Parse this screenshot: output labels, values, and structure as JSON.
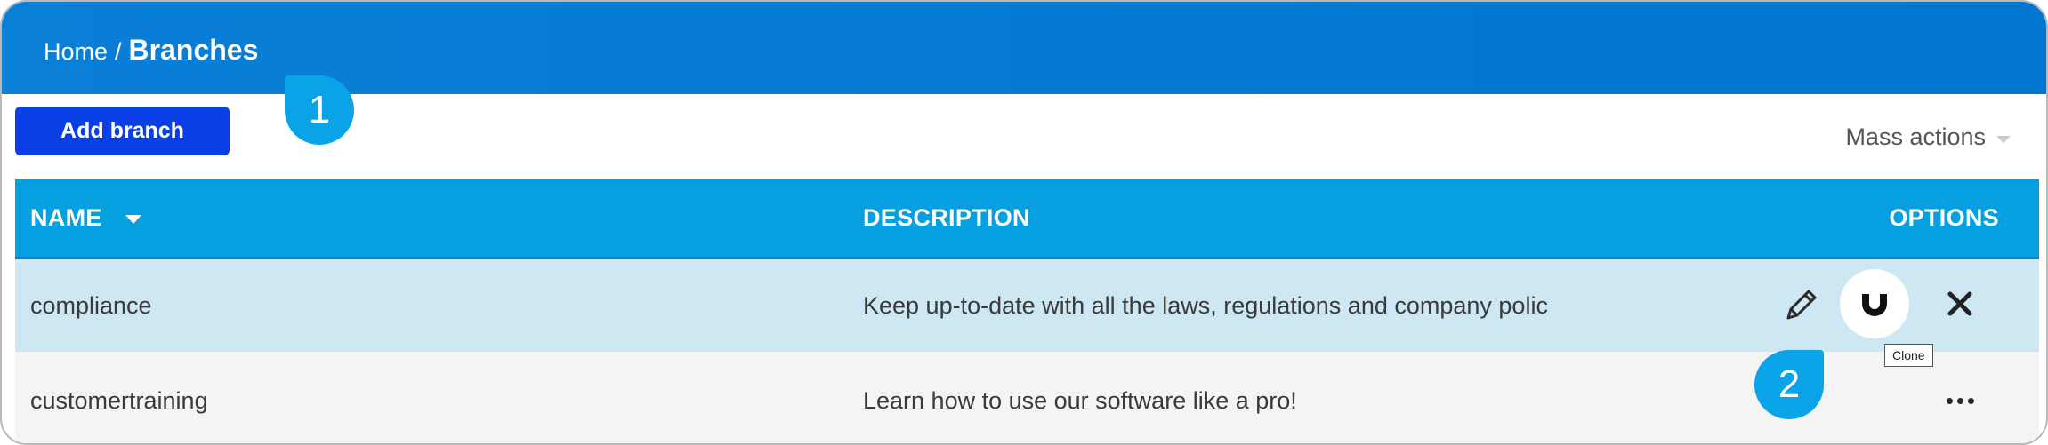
{
  "breadcrumb": {
    "home": "Home",
    "separator": "/",
    "current": "Branches"
  },
  "toolbar": {
    "add_branch_label": "Add branch",
    "mass_actions_label": "Mass actions"
  },
  "table": {
    "columns": {
      "name": "NAME",
      "description": "DESCRIPTION",
      "options": "OPTIONS"
    },
    "rows": [
      {
        "name": "compliance",
        "description": "Keep up-to-date with all the laws, regulations and company polic"
      },
      {
        "name": "customertraining",
        "description": "Learn how to use our software like a pro!"
      }
    ]
  },
  "tooltip": {
    "text": "Clone"
  },
  "markers": {
    "first": "1",
    "second": "2"
  },
  "colors": {
    "topbar": "#0a7fd6",
    "accent_button": "#0b3fe6",
    "table_header": "#069fe0",
    "selected_row": "#cde7f3",
    "marker": "#0aa3e8"
  },
  "icons": {
    "edit": "pencil-icon",
    "clone": "magnet-icon",
    "delete": "close-icon",
    "more": "more-horizontal-icon",
    "sort": "caret-down-icon",
    "mass_actions": "chevron-down-icon"
  }
}
